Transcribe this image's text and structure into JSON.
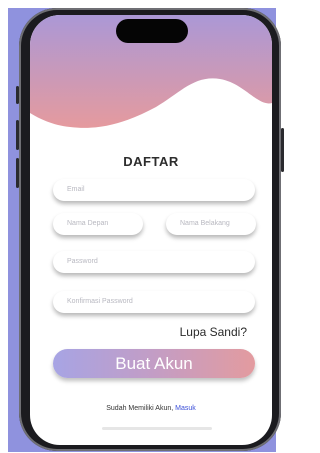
{
  "form": {
    "title": "DAFTAR",
    "email_placeholder": "Email",
    "first_name_placeholder": "Nama Depan",
    "last_name_placeholder": "Nama Belakang",
    "password_placeholder": "Password",
    "confirm_password_placeholder": "Konfirmasi Password",
    "forgot_label": "Lupa Sandi?",
    "submit_label": "Buat Akun"
  },
  "footer": {
    "prompt": "Sudah Memiliki Akun,",
    "login_link": "Masuk"
  },
  "colors": {
    "backdrop": "#8f92de",
    "gradient_left": "#a7a4e4",
    "gradient_right": "#e39b9f",
    "link": "#3b4fd8"
  }
}
